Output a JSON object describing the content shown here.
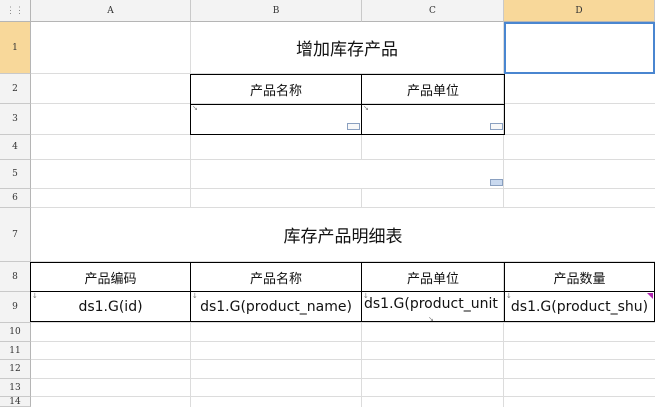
{
  "columns": [
    "A",
    "B",
    "C",
    "D"
  ],
  "rows": [
    "1",
    "2",
    "3",
    "4",
    "5",
    "6",
    "7",
    "8",
    "9",
    "10",
    "11",
    "12",
    "13",
    "14"
  ],
  "selected_cell": {
    "column": "D",
    "row": "1"
  },
  "corner_icon": "grid-icon",
  "form": {
    "title": "增加库存产品",
    "headers": [
      "产品名称",
      "产品单位"
    ]
  },
  "detail": {
    "title": "库存产品明细表",
    "headers": [
      "产品编码",
      "产品名称",
      "产品单位",
      "产品数量"
    ],
    "values": [
      "ds1.G(id)",
      "ds1.G(product_name)",
      "ds1.G(product_unit",
      "ds1.G(product_shu)"
    ]
  },
  "colors": {
    "header_bg": "#f3f3f3",
    "active_header": "#f8d89a",
    "selection": "#4a86d0",
    "grid": "#dcdcdc"
  }
}
